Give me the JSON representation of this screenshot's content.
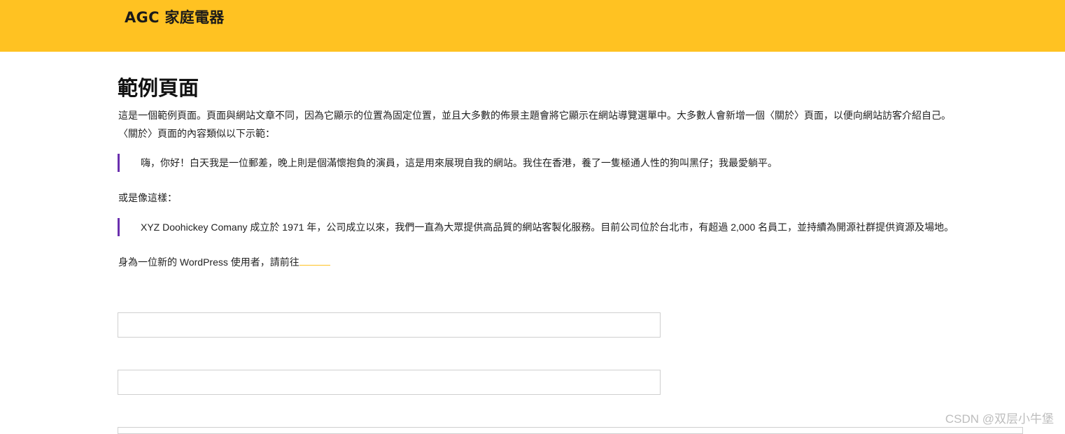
{
  "header": {
    "site_title": "AGC 家庭電器",
    "background_color": "#ffc222"
  },
  "main": {
    "page_title": "範例頁面",
    "intro_line_1": "這是一個範例頁面。頁面與網站文章不同，因為它顯示的位置為固定位置，並且大多數的佈景主題會將它顯示在網站導覽選單中。大多數人會新增一個〈關於〉頁面，以便向網站訪客介紹自己。",
    "intro_line_2": "〈關於〉頁面的內容類似以下示範：",
    "quote_1": "嗨，你好！白天我是一位郵差，晚上則是個滿懷抱負的演員，這是用來展現自我的網站。我住在香港，養了一隻極通人性的狗叫黑仔；我最愛躺平。",
    "or_like": "或是像這樣：",
    "quote_2": "XYZ Doohickey Comany 成立於 1971 年，公司成立以來，我們一直為大眾提供高品質的網站客製化服務。目前公司位於台北市，有超過 2,000 名員工，並持續為開源社群提供資源及場地。",
    "as_new_user": "身為一位新的 WordPress 使用者，請前往",
    "quote_border_color": "#6a2fae"
  },
  "form": {
    "field_1_value": "",
    "field_2_value": "",
    "field_3_value": ""
  },
  "watermark": "CSDN @双层小牛堡"
}
